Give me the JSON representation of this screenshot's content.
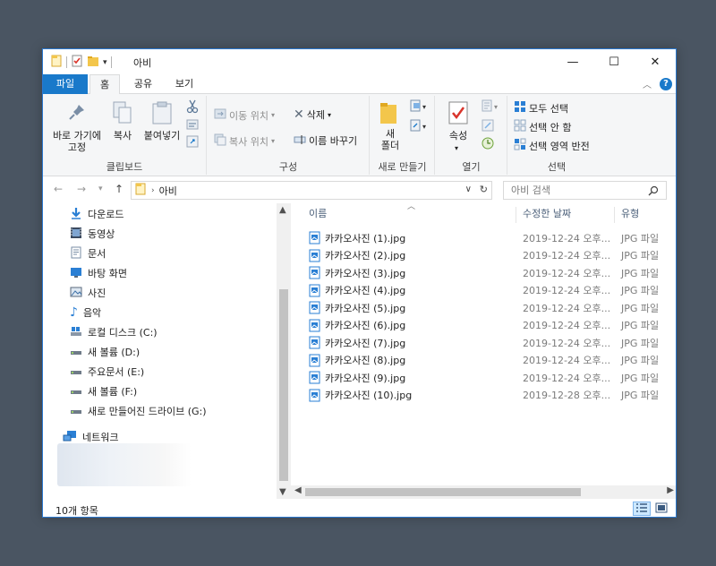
{
  "window": {
    "title": "아비",
    "controls": {
      "minimize": "—",
      "maximize": "☐",
      "close": "✕"
    }
  },
  "ribbon": {
    "tabs": [
      "파일",
      "홈",
      "공유",
      "보기"
    ],
    "clipboard": {
      "pin_label": "바로 가기에\n고정",
      "copy_label": "복사",
      "paste_label": "붙여넣기",
      "group_label": "클립보드"
    },
    "organize": {
      "move_to": "이동 위치",
      "copy_to": "복사 위치",
      "delete": "삭제",
      "rename": "이름 바꾸기",
      "group_label": "구성"
    },
    "new": {
      "new_folder": "새\n폴더",
      "group_label": "새로 만들기"
    },
    "open": {
      "properties": "속성",
      "group_label": "열기"
    },
    "select": {
      "select_all": "모두 선택",
      "select_none": "선택 안 함",
      "invert": "선택 영역 반전",
      "group_label": "선택"
    }
  },
  "address": {
    "path": "아비",
    "search_placeholder": "아비 검색"
  },
  "nav": {
    "items": [
      {
        "label": "다운로드",
        "icon": "download-icon"
      },
      {
        "label": "동영상",
        "icon": "video-icon"
      },
      {
        "label": "문서",
        "icon": "document-icon"
      },
      {
        "label": "바탕 화면",
        "icon": "desktop-icon"
      },
      {
        "label": "사진",
        "icon": "pictures-icon"
      },
      {
        "label": "음악",
        "icon": "music-icon"
      },
      {
        "label": "로컬 디스크 (C:)",
        "icon": "local-disk-icon"
      },
      {
        "label": "새 볼륨 (D:)",
        "icon": "drive-icon"
      },
      {
        "label": "주요문서 (E:)",
        "icon": "drive-icon"
      },
      {
        "label": "새 볼륨 (F:)",
        "icon": "drive-icon"
      },
      {
        "label": "새로 만들어진 드라이브 (G:)",
        "icon": "drive-icon"
      }
    ],
    "network": "네트워크"
  },
  "filelist": {
    "columns": {
      "name": "이름",
      "date": "수정한 날짜",
      "type": "유형"
    },
    "files": [
      {
        "name": "카카오사진 (1).jpg",
        "date": "2019-12-24 오후...",
        "type": "JPG 파일"
      },
      {
        "name": "카카오사진 (2).jpg",
        "date": "2019-12-24 오후...",
        "type": "JPG 파일"
      },
      {
        "name": "카카오사진 (3).jpg",
        "date": "2019-12-24 오후...",
        "type": "JPG 파일"
      },
      {
        "name": "카카오사진 (4).jpg",
        "date": "2019-12-24 오후...",
        "type": "JPG 파일"
      },
      {
        "name": "카카오사진 (5).jpg",
        "date": "2019-12-24 오후...",
        "type": "JPG 파일"
      },
      {
        "name": "카카오사진 (6).jpg",
        "date": "2019-12-24 오후...",
        "type": "JPG 파일"
      },
      {
        "name": "카카오사진 (7).jpg",
        "date": "2019-12-24 오후...",
        "type": "JPG 파일"
      },
      {
        "name": "카카오사진 (8).jpg",
        "date": "2019-12-24 오후...",
        "type": "JPG 파일"
      },
      {
        "name": "카카오사진 (9).jpg",
        "date": "2019-12-24 오후...",
        "type": "JPG 파일"
      },
      {
        "name": "카카오사진 (10).jpg",
        "date": "2019-12-28 오후...",
        "type": "JPG 파일"
      }
    ]
  },
  "status": {
    "count": "10개 항목"
  },
  "colors": {
    "accent": "#1979ca",
    "folder": "#f3c64b",
    "background": "#4a5562"
  }
}
